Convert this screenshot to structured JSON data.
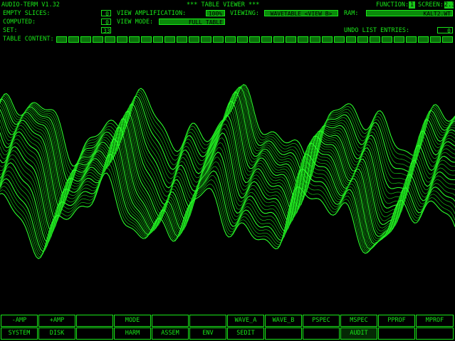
{
  "header": {
    "app": "AUDIO-TERM V1.32",
    "title": "*** TABLE VIEWER ***",
    "function_label": "FUNCTION:",
    "function_value": "1",
    "screen_label": "SCREEN:",
    "screen_value": "2.3"
  },
  "fields": {
    "empty_slices_label": "EMPTY SLICES:",
    "empty_slices_value": "0",
    "computed_label": "COMPUTED:",
    "computed_value": "0",
    "set_label": "SET:",
    "set_value": "33",
    "view_amp_label": "VIEW AMPLIFICATION:",
    "view_amp_value": "100%",
    "view_mode_label": "VIEW MODE:",
    "view_mode_value": "FULL TABLE",
    "viewing_label": "VIEWING:",
    "viewing_value": "WAVETABLE <VIEW B>",
    "ram_label": "RAM:",
    "ram_value": "KALT2.WT",
    "undo_label": "UNDO LIST ENTRIES:",
    "undo_value": "0",
    "table_content_label": "TABLE CONTENT:"
  },
  "buttons_row1": [
    "-AMP",
    "+AMP",
    "",
    "MODE",
    "",
    "",
    "WAVE_A",
    "WAVE_B",
    "PSPEC",
    "MSPEC",
    "PPROF",
    "MPROF"
  ],
  "buttons_row2": [
    "SYSTEM",
    "DISK",
    "",
    "HARM",
    "ASSEM",
    "ENV",
    "SEDIT",
    "",
    "",
    "AUDIT",
    "",
    ""
  ],
  "colors": {
    "foreground": "#19e619",
    "background": "#000000",
    "fill": "#0a8a0a"
  }
}
